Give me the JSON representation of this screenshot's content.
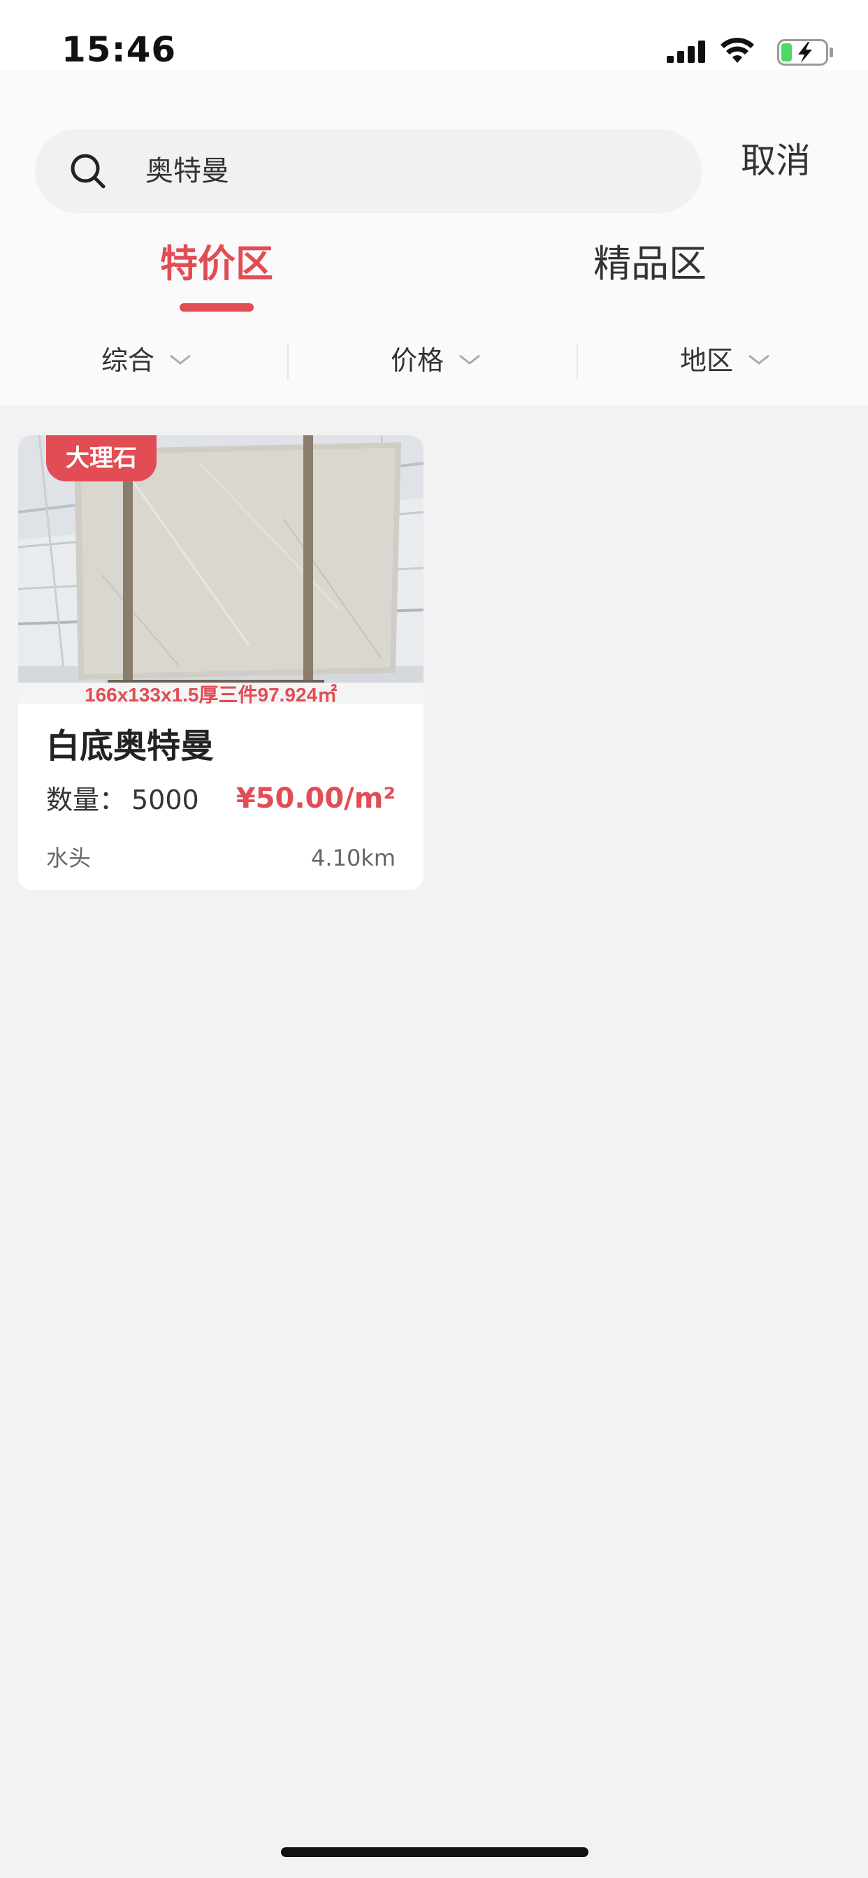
{
  "status_bar": {
    "time": "15:46",
    "icons": [
      "cellular-signal-icon",
      "wifi-icon",
      "battery-charging-icon"
    ]
  },
  "search": {
    "query": "奥特曼",
    "icon": "search-icon",
    "cancel_label": "取消"
  },
  "tabs": [
    {
      "label": "特价区",
      "active": true
    },
    {
      "label": "精品区",
      "active": false
    }
  ],
  "filters": [
    {
      "label": "综合",
      "icon": "chevron-down-icon"
    },
    {
      "label": "价格",
      "icon": "chevron-down-icon"
    },
    {
      "label": "地区",
      "icon": "chevron-down-icon"
    }
  ],
  "products": [
    {
      "category": "大理石",
      "image_caption": "166x133x1.5厚三件97.924㎡",
      "title": "白底奥特曼",
      "quantity_label": "数量：",
      "quantity": "5000",
      "price": "¥50.00/m²",
      "location": "水头",
      "distance": "4.10km"
    }
  ],
  "colors": {
    "accent": "#e24c55",
    "background": "#f2f2f2",
    "card": "#ffffff",
    "search_field": "#f1f1f1"
  }
}
